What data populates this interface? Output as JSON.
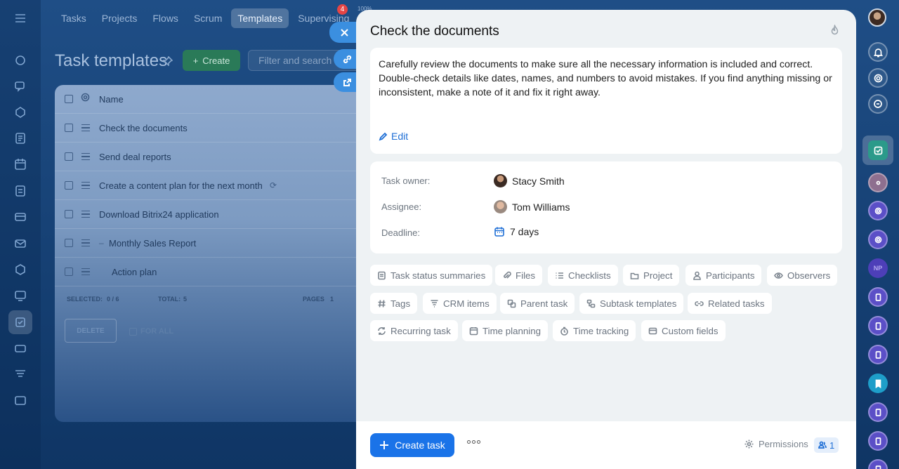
{
  "nav": {
    "tabs": [
      "Tasks",
      "Projects",
      "Flows",
      "Scrum",
      "Templates",
      "Supervising"
    ],
    "active_tab": "Templates",
    "badge": "4",
    "pct": "100%"
  },
  "header": {
    "title": "Task templates",
    "create_label": "Create",
    "filter_placeholder": "Filter and search"
  },
  "list": {
    "column_name": "Name",
    "rows": [
      "Check the documents",
      "Send deal reports",
      "Create a content plan for the next month",
      "Download Bitrix24 application",
      "Monthly Sales Report",
      "Action plan"
    ],
    "selected_label": "SELECTED:",
    "selected_value": "0 / 6",
    "total_label": "TOTAL:",
    "total_value": "5",
    "pages_label": "PAGES",
    "pages_value": "1",
    "delete_label": "DELETE",
    "for_all_label": "FOR ALL"
  },
  "task": {
    "title": "Check the documents",
    "description": "Carefully review the documents to make sure all the necessary information is included and correct. Double-check details like dates, names, and numbers to avoid mistakes. If you find anything missing or inconsistent, make a note of it and fix it right away.",
    "edit_label": "Edit",
    "owner_label": "Task owner:",
    "owner_name": "Stacy Smith",
    "assignee_label": "Assignee:",
    "assignee_name": "Tom Williams",
    "deadline_label": "Deadline:",
    "deadline_value": "7 days",
    "chips": [
      "Task status summaries",
      "Files",
      "Checklists",
      "Project",
      "Participants",
      "Observers",
      "Tags",
      "CRM items",
      "Parent task",
      "Subtask templates",
      "Related tasks",
      "Recurring task",
      "Time planning",
      "Time tracking",
      "Custom fields"
    ],
    "create_task_label": "Create task",
    "permissions_label": "Permissions",
    "permissions_count": "1"
  },
  "right_rail": {
    "np_label": "NP"
  },
  "colors": {
    "primary": "#1a73e8",
    "create_green": "#2a7a58",
    "badge_red": "#e64545"
  }
}
